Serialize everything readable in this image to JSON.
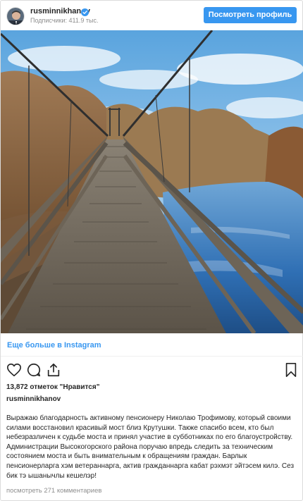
{
  "header": {
    "username": "rusminnikhanov",
    "followers": "Подписчики: 411.9 тыс.",
    "profile_button": "Посмотреть профиль",
    "verified": true
  },
  "post": {
    "image_description_icon": "suspension-bridge-photo",
    "more_link": "Еще больше в Instagram",
    "likes": "13,872 отметок \"Нравится\"",
    "caption_username": "rusminnikhanov",
    "caption_text": "Выражаю благодарность активному пенсионеру Николаю Трофимову, который своими силами восстановил красивый мост близ Крутушки. Также спасибо всем, кто был небезразличен к судьбе моста и принял участие в субботниках по его благоустройству. Администрации Высокогорского района поручаю впредь следить за техническим состоянием моста и быть внимательным к обращениям граждан. Барлык пенсионерларга хэм ветераннарга, актив гражданнарга кабат рэхмэт эйтэсем килэ. Сез бик тэ ышанычлы кешелэр!",
    "comments": "посмотреть 271 комментариев"
  },
  "actions": {
    "like_icon": "heart-icon",
    "comment_icon": "comment-icon",
    "share_icon": "share-icon",
    "save_icon": "bookmark-icon"
  },
  "colors": {
    "accent": "#3897f0",
    "text": "#262626",
    "muted": "#8e8e8e",
    "border": "#dbdbdb"
  }
}
